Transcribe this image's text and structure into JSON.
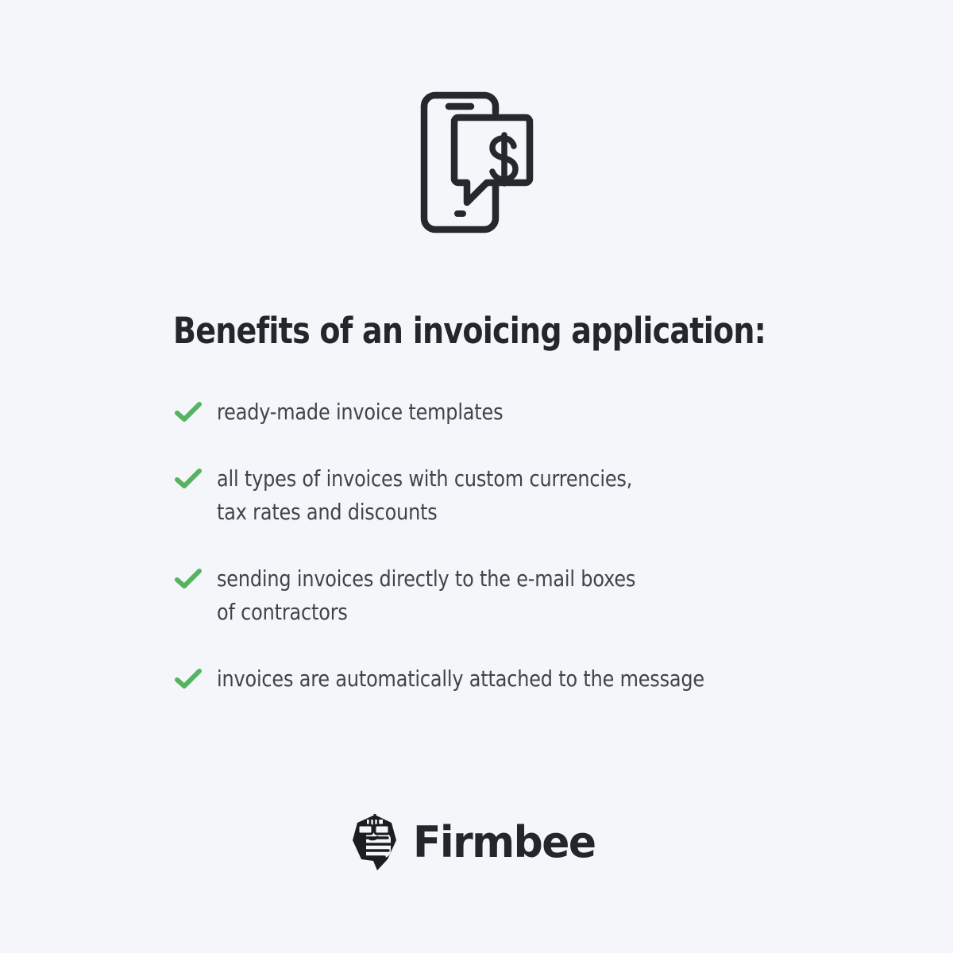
{
  "page": {
    "background_color": "#f4f6fa",
    "text_color": "#3e444c",
    "heading_color": "#23262b",
    "accent_color": "#55b361"
  },
  "hero": {
    "icon_name": "smartphone-money-message-icon",
    "currency_symbol": "$"
  },
  "heading": {
    "text": "Benefits of an invoicing application:"
  },
  "benefits": {
    "check_icon_name": "check-icon",
    "items": [
      {
        "text": "ready-made invoice templates"
      },
      {
        "text": "all types of invoices with custom currencies,\ntax rates and discounts"
      },
      {
        "text": "sending invoices directly to the e-mail boxes\nof contractors"
      },
      {
        "text": " invoices are automatically attached to the message"
      }
    ]
  },
  "brand": {
    "logo_icon_name": "firmbee-bee-logo-icon",
    "name": "Firmbee"
  }
}
